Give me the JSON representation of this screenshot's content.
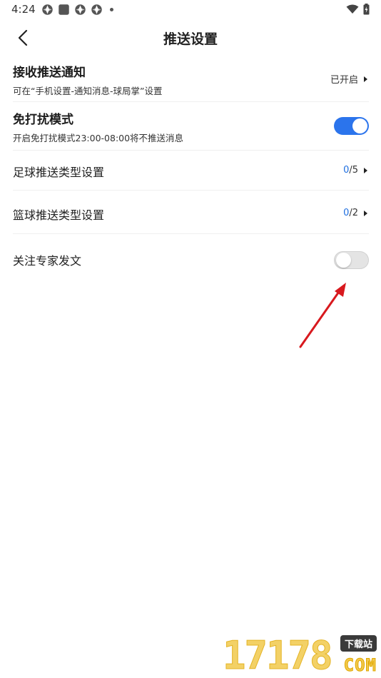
{
  "status_bar": {
    "time": "4:24"
  },
  "header": {
    "title": "推送设置"
  },
  "settings": {
    "receive_notifications": {
      "title": "接收推送通知",
      "subtitle": "可在“手机设置-通知消息-球局掌”设置",
      "value": "已开启"
    },
    "do_not_disturb": {
      "title": "免打扰模式",
      "subtitle": "开启免打扰模式23:00-08:00将不推送消息",
      "enabled": true
    },
    "football_types": {
      "title": "足球推送类型设置",
      "selected": "0",
      "total": "/5"
    },
    "basketball_types": {
      "title": "篮球推送类型设置",
      "selected": "0",
      "total": "/2"
    },
    "follow_expert_posts": {
      "title": "关注专家发文",
      "enabled": false
    }
  },
  "watermark": {
    "digits": "17178",
    "badge": "下载站",
    "suffix": "COM"
  },
  "colors": {
    "accent": "#2b74ec",
    "count_highlight": "#1f6fe0",
    "toggle_off": "#e4e4e4",
    "annotation_arrow": "#d8191e"
  },
  "icons": {
    "back": "chevron-left-icon",
    "row_arrow": "triangle-right-icon",
    "wifi": "wifi-icon",
    "battery": "battery-icon"
  }
}
